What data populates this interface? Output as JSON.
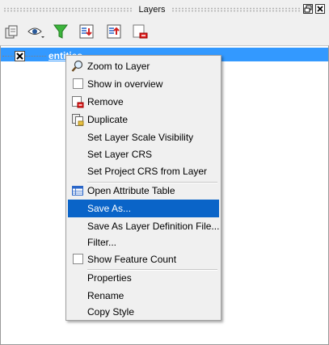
{
  "panel": {
    "title": "Layers"
  },
  "toolbar": {
    "items": [
      {
        "name": "add-group-icon"
      },
      {
        "name": "visibility-eye-icon"
      },
      {
        "name": "filter-legend-icon"
      },
      {
        "name": "expand-all-icon"
      },
      {
        "name": "collapse-all-icon"
      },
      {
        "name": "remove-layer-icon"
      }
    ]
  },
  "layer": {
    "name": "entities",
    "visible": true,
    "selected": true
  },
  "context_menu": {
    "items": [
      {
        "label": "Zoom to Layer",
        "icon": "zoom-icon"
      },
      {
        "label": "Show in overview",
        "checkbox": true,
        "checked": false
      },
      {
        "label": "Remove",
        "icon": "remove-icon"
      },
      {
        "label": "Duplicate",
        "icon": "duplicate-icon"
      },
      {
        "label": "Set Layer Scale Visibility"
      },
      {
        "label": "Set Layer CRS"
      },
      {
        "label": "Set Project CRS from Layer"
      },
      {
        "label": "Open Attribute Table",
        "icon": "table-icon"
      },
      {
        "label": "Save As...",
        "highlighted": true
      },
      {
        "label": "Save As Layer Definition File..."
      },
      {
        "label": "Filter..."
      },
      {
        "label": "Show Feature Count",
        "checkbox": true,
        "checked": false
      },
      {
        "label": "Properties"
      },
      {
        "label": "Rename"
      },
      {
        "label": "Copy Style"
      }
    ]
  },
  "colors": {
    "selection": "#3399ff",
    "menu_highlight": "#0a64c8"
  }
}
